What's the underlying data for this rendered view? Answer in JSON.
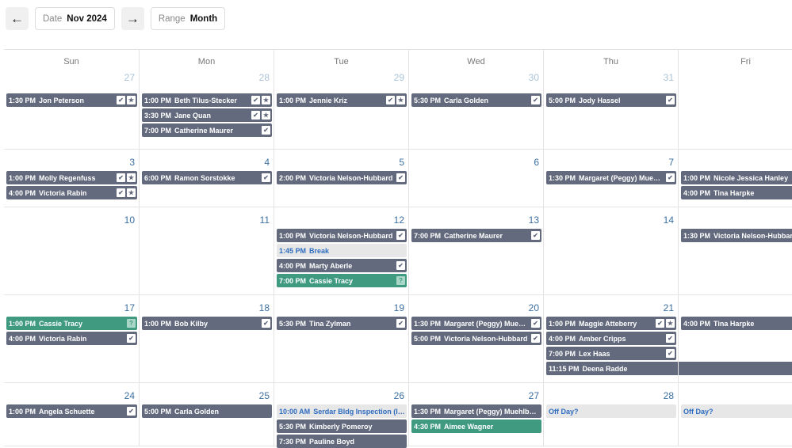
{
  "toolbar": {
    "prev_icon": "arrow-left-icon",
    "next_icon": "arrow-right-icon",
    "date_label": "Date",
    "date_value": "Nov 2024",
    "range_label": "Range",
    "range_value": "Month"
  },
  "colors": {
    "gray": "#636a7d",
    "green": "#3f9a80",
    "light": "#e7e7e7",
    "date_current": "#3b6fa0",
    "date_other": "#abc3d8"
  },
  "weekdays": [
    "Sun",
    "Mon",
    "Tue",
    "Wed",
    "Thu",
    "Fri"
  ],
  "weeks": [
    {
      "days": [
        {
          "date": "27",
          "other": true,
          "events": [
            {
              "time": "1:30 PM",
              "title": "Jon Peterson",
              "style": "gray",
              "icons": [
                "check",
                "star"
              ]
            }
          ]
        },
        {
          "date": "28",
          "other": true,
          "events": [
            {
              "time": "1:00 PM",
              "title": "Beth Tilus-Stecker",
              "style": "gray",
              "icons": [
                "check",
                "star"
              ]
            },
            {
              "time": "3:30 PM",
              "title": "Jane Quan",
              "style": "gray",
              "icons": [
                "check",
                "star"
              ]
            },
            {
              "time": "7:00 PM",
              "title": "Catherine Maurer",
              "style": "gray",
              "icons": [
                "check"
              ]
            }
          ]
        },
        {
          "date": "29",
          "other": true,
          "events": [
            {
              "time": "1:00 PM",
              "title": "Jennie Kriz",
              "style": "gray",
              "icons": [
                "check",
                "star"
              ]
            }
          ]
        },
        {
          "date": "30",
          "other": true,
          "events": [
            {
              "time": "5:30 PM",
              "title": "Carla Golden",
              "style": "gray",
              "icons": [
                "check"
              ]
            }
          ]
        },
        {
          "date": "31",
          "other": true,
          "events": [
            {
              "time": "5:00 PM",
              "title": "Jody Hassel",
              "style": "gray",
              "icons": [
                "check"
              ]
            }
          ]
        },
        {
          "date": "",
          "other": true,
          "events": []
        }
      ]
    },
    {
      "days": [
        {
          "date": "3",
          "events": [
            {
              "time": "1:00 PM",
              "title": "Molly Regenfuss",
              "style": "gray",
              "icons": [
                "check",
                "star"
              ]
            },
            {
              "time": "4:00 PM",
              "title": "Victoria Rabin",
              "style": "gray",
              "icons": [
                "check",
                "star"
              ]
            }
          ]
        },
        {
          "date": "4",
          "events": [
            {
              "time": "6:00 PM",
              "title": "Ramon Sorstokke",
              "style": "gray",
              "icons": [
                "check"
              ]
            }
          ]
        },
        {
          "date": "5",
          "events": [
            {
              "time": "2:00 PM",
              "title": "Victoria Nelson-Hubbard",
              "style": "gray",
              "icons": [
                "check"
              ]
            }
          ]
        },
        {
          "date": "6",
          "events": []
        },
        {
          "date": "7",
          "events": [
            {
              "time": "1:30 PM",
              "title": "Margaret (Peggy) Muehl...",
              "style": "gray",
              "icons": [
                "check"
              ]
            }
          ]
        },
        {
          "date": "",
          "events": [
            {
              "time": "1:00 PM",
              "title": "Nicole Jessica Hanley",
              "style": "gray",
              "icons": []
            },
            {
              "time": "4:00 PM",
              "title": "Tina Harpke",
              "style": "gray",
              "icons": []
            }
          ]
        }
      ]
    },
    {
      "days": [
        {
          "date": "10",
          "events": []
        },
        {
          "date": "11",
          "events": []
        },
        {
          "date": "12",
          "events": [
            {
              "time": "1:00 PM",
              "title": "Victoria Nelson-Hubbard",
              "style": "gray",
              "icons": [
                "check"
              ]
            },
            {
              "time": "1:45 PM",
              "title": "Break",
              "style": "light",
              "icons": []
            },
            {
              "time": "4:00 PM",
              "title": "Marty Aberle",
              "style": "gray",
              "icons": [
                "check"
              ]
            },
            {
              "time": "7:00 PM",
              "title": "Cassie Tracy",
              "style": "green",
              "icons": [
                "question"
              ]
            }
          ]
        },
        {
          "date": "13",
          "events": [
            {
              "time": "7:00 PM",
              "title": "Catherine Maurer",
              "style": "gray",
              "icons": [
                "check"
              ]
            }
          ]
        },
        {
          "date": "14",
          "events": []
        },
        {
          "date": "",
          "events": [
            {
              "time": "1:30 PM",
              "title": "Victoria Nelson-Hubbard",
              "style": "gray",
              "icons": []
            }
          ]
        }
      ]
    },
    {
      "days": [
        {
          "date": "17",
          "events": [
            {
              "time": "1:00 PM",
              "title": "Cassie Tracy",
              "style": "green",
              "icons": [
                "question"
              ]
            },
            {
              "time": "4:00 PM",
              "title": "Victoria Rabin",
              "style": "gray",
              "icons": [
                "check"
              ]
            }
          ]
        },
        {
          "date": "18",
          "events": [
            {
              "time": "1:00 PM",
              "title": "Bob Kilby",
              "style": "gray",
              "icons": [
                "check"
              ]
            }
          ]
        },
        {
          "date": "19",
          "events": [
            {
              "time": "5:30 PM",
              "title": "Tina Zylman",
              "style": "gray",
              "icons": [
                "check"
              ]
            }
          ]
        },
        {
          "date": "20",
          "events": [
            {
              "time": "1:30 PM",
              "title": "Margaret (Peggy) Muehl...",
              "style": "gray",
              "icons": [
                "check"
              ]
            },
            {
              "time": "5:00 PM",
              "title": "Victoria Nelson-Hubbard",
              "style": "gray",
              "icons": [
                "check"
              ]
            }
          ]
        },
        {
          "date": "21",
          "events": [
            {
              "time": "1:00 PM",
              "title": "Maggie Atteberry",
              "style": "gray",
              "icons": [
                "check",
                "star"
              ]
            },
            {
              "time": "4:00 PM",
              "title": "Amber Cripps",
              "style": "gray",
              "icons": [
                "check"
              ]
            },
            {
              "time": "7:00 PM",
              "title": "Lex Haas",
              "style": "gray",
              "icons": [
                "check"
              ]
            },
            {
              "time": "11:15 PM",
              "title": "Deena Radde",
              "style": "gray",
              "icons": [],
              "span": 2
            }
          ]
        },
        {
          "date": "",
          "events": [
            {
              "time": "4:00 PM",
              "title": "Tina Harpke",
              "style": "gray",
              "icons": []
            }
          ]
        }
      ]
    },
    {
      "days": [
        {
          "date": "24",
          "events": [
            {
              "time": "1:00 PM",
              "title": "Angela Schuette",
              "style": "gray",
              "icons": [
                "check"
              ]
            }
          ]
        },
        {
          "date": "25",
          "events": [
            {
              "time": "5:00 PM",
              "title": "Carla Golden",
              "style": "gray",
              "icons": []
            }
          ]
        },
        {
          "date": "26",
          "events": [
            {
              "time": "10:00 AM",
              "title": "Serdar Bldg Inspection (In...",
              "style": "light",
              "icons": []
            },
            {
              "time": "5:30 PM",
              "title": "Kimberly Pomeroy",
              "style": "gray",
              "icons": []
            },
            {
              "time": "7:30 PM",
              "title": "Pauline Boyd",
              "style": "gray",
              "icons": []
            }
          ]
        },
        {
          "date": "27",
          "events": [
            {
              "time": "1:30 PM",
              "title": "Margaret (Peggy) Muehlberg",
              "style": "gray",
              "icons": []
            },
            {
              "time": "4:30 PM",
              "title": "Aimee Wagner",
              "style": "green",
              "icons": []
            }
          ]
        },
        {
          "date": "28",
          "events": [
            {
              "time": "",
              "title": "Off Day?",
              "style": "light",
              "icons": []
            }
          ]
        },
        {
          "date": "",
          "events": [
            {
              "time": "",
              "title": "Off Day?",
              "style": "light",
              "icons": []
            }
          ]
        }
      ]
    }
  ]
}
